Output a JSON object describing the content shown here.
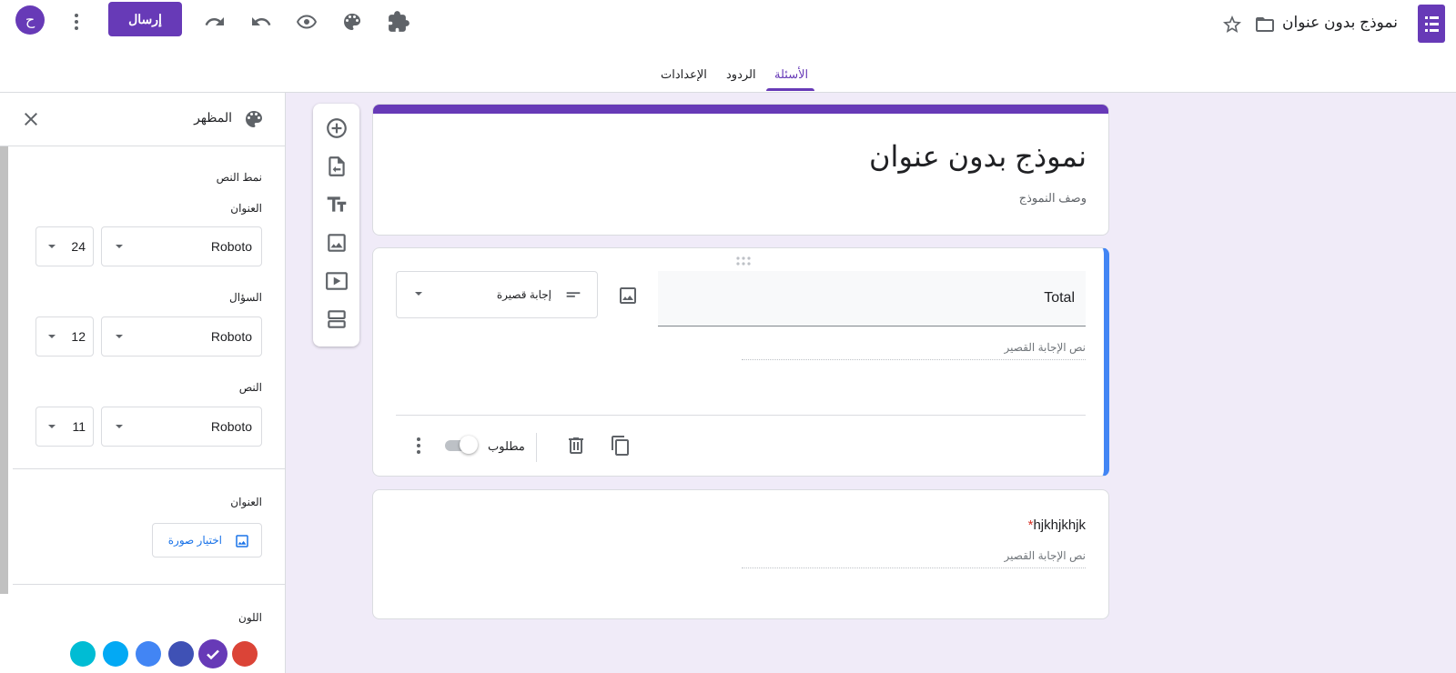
{
  "header": {
    "doc_title": "نموذج بدون عنوان",
    "send_label": "إرسال",
    "avatar_letter": "ح",
    "icons": [
      "forms-app-icon",
      "star-icon",
      "folder-icon",
      "addon-icon",
      "palette-icon",
      "preview-eye-icon",
      "undo-icon",
      "redo-icon",
      "more-vert-icon"
    ]
  },
  "tabs": [
    {
      "label": "الأسئلة",
      "selected": true
    },
    {
      "label": "الردود",
      "selected": false
    },
    {
      "label": "الإعدادات",
      "selected": false
    }
  ],
  "theme_panel": {
    "title": "المظهر",
    "text_style_label": "نمط النص",
    "header_label": "العنوان",
    "header_font": "Roboto",
    "header_size": "24",
    "question_label": "السؤال",
    "question_font": "Roboto",
    "question_size": "12",
    "text_label": "النص",
    "text_font": "Roboto",
    "text_size": "11",
    "header_image_label": "العنوان",
    "choose_image_label": "اختيار صورة",
    "color_label": "اللون",
    "colors": [
      "#db4437",
      "#673ab7",
      "#3f51b5",
      "#4285f4",
      "#03a9f4",
      "#00bcd4"
    ],
    "selected_color": "#673ab7"
  },
  "form": {
    "title": "نموذج بدون عنوان",
    "description_placeholder": "وصف النموذج",
    "questions": [
      {
        "title": "Total",
        "type_label": "إجابة قصيرة",
        "answer_placeholder": "نص الإجابة القصير",
        "required_label": "مطلوب",
        "required": false
      },
      {
        "title": "hjkhjkhjk",
        "required_star": "*",
        "answer_placeholder": "نص الإجابة القصير"
      }
    ]
  },
  "accent_color": "#673ab7"
}
